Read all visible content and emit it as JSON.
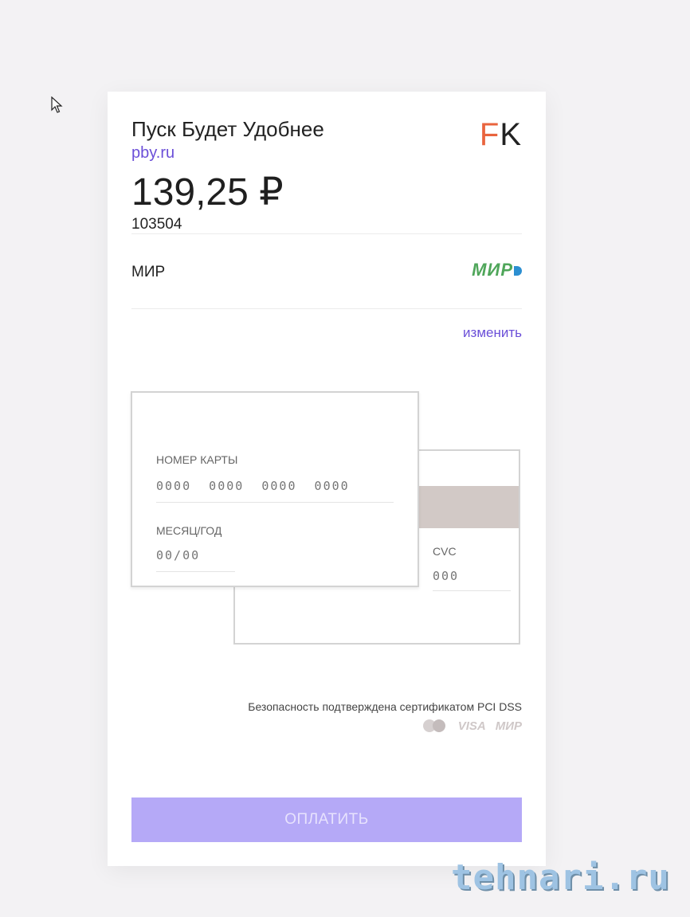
{
  "merchant": {
    "name": "Пуск Будет Удобнее",
    "site": "pby.ru",
    "logo_f": "F",
    "logo_k": "K"
  },
  "payment": {
    "amount": "139,25 ₽",
    "order_id": "103504"
  },
  "method": {
    "label": "МИР",
    "logo_text": "МИР",
    "change_label": "изменить"
  },
  "card_form": {
    "number_label": "НОМЕР КАРТЫ",
    "number_placeholder": "0000  0000  0000  0000",
    "expiry_label": "МЕСЯЦ/ГОД",
    "expiry_placeholder": "00/00",
    "cvc_label": "CVC",
    "cvc_placeholder": "000"
  },
  "security": {
    "text": "Безопасность подтверждена сертификатом PCI DSS",
    "logos": [
      "mastercard-icon",
      "visa-icon",
      "mir-icon"
    ],
    "visa_text": "VISA",
    "mir_text": "МИР"
  },
  "pay_button_label": "ОПЛАТИТЬ",
  "watermark": "tehnari.ru",
  "colors": {
    "accent": "#6b4fd8",
    "button": "#b5a9f7",
    "mir_green": "#4fa65a",
    "logo_orange": "#e9643e"
  }
}
